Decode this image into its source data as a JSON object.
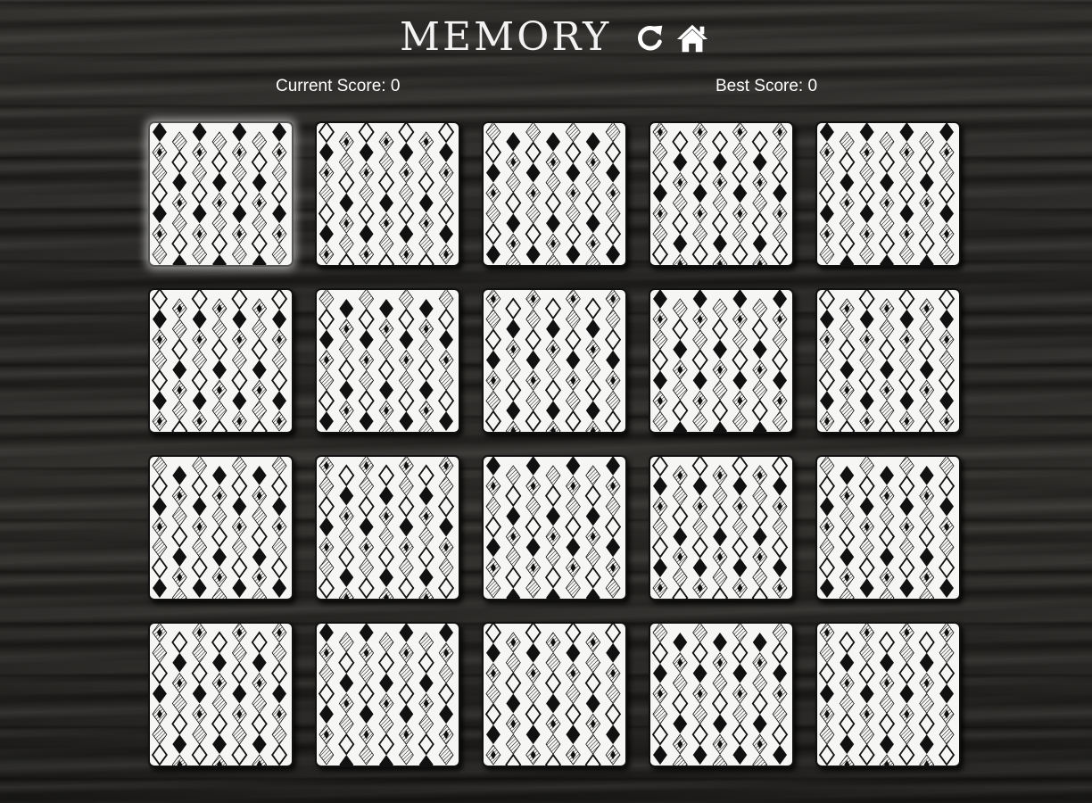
{
  "header": {
    "title": "MEMORY",
    "restart_icon": "restart-icon",
    "home_icon": "home-icon"
  },
  "scores": {
    "current_label": "Current Score: 0",
    "best_label": "Best Score: 0",
    "current": 0,
    "best": 0
  },
  "board": {
    "rows": 4,
    "columns": 5,
    "card_state": "face-down",
    "card_back_pattern": "diamonds",
    "highlighted_card": 1
  },
  "colors": {
    "card_face": "#f6f6f4",
    "card_border": "#111111",
    "pattern": "#111111",
    "text": "#ffffff"
  }
}
